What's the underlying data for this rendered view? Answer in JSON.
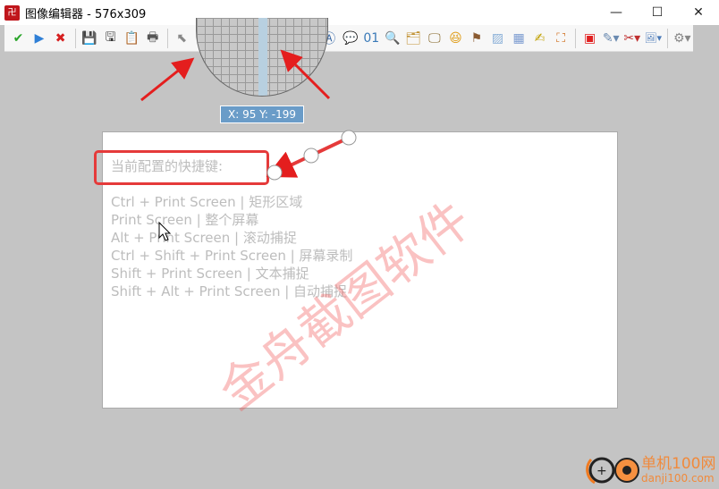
{
  "window": {
    "title": "图像编辑器 - 576x309",
    "minimize": "—",
    "maximize": "☐",
    "close": "✕"
  },
  "toolbar": [
    {
      "name": "apply",
      "glyph": "✔",
      "color": "#2aa52a"
    },
    {
      "name": "play",
      "glyph": "▶",
      "color": "#2f7fd6"
    },
    {
      "name": "cancel",
      "glyph": "✖",
      "color": "#d62020"
    },
    {
      "sep": true
    },
    {
      "name": "save",
      "glyph": "💾",
      "color": "#333"
    },
    {
      "name": "save-all",
      "glyph": "🖫",
      "color": "#333"
    },
    {
      "name": "clipboard",
      "glyph": "📋",
      "color": "#a07030"
    },
    {
      "name": "print",
      "glyph": "🖶",
      "color": "#555"
    },
    {
      "sep": true
    },
    {
      "name": "select",
      "glyph": "⬉",
      "color": "#888"
    },
    {
      "name": "rectangle",
      "glyph": "▭",
      "color": "#4a7ab8"
    },
    {
      "name": "ellipse",
      "glyph": "⬭",
      "color": "#4a7ab8"
    },
    {
      "name": "pencil",
      "glyph": "✎",
      "color": "#c08030"
    },
    {
      "name": "line",
      "glyph": "⟋",
      "color": "#4a7ab8"
    },
    {
      "name": "arrow",
      "glyph": "↘",
      "color": "#4a7ab8",
      "selected": true
    },
    {
      "name": "text",
      "glyph": "A",
      "color": "#3a6aa8"
    },
    {
      "name": "text-box",
      "glyph": "Ⓐ",
      "color": "#3a6aa8"
    },
    {
      "name": "speech-bubble",
      "glyph": "💬",
      "color": "#6a9ac8"
    },
    {
      "name": "counter",
      "glyph": "01",
      "color": "#3a7ab8"
    },
    {
      "name": "magnifier",
      "glyph": "🔍",
      "color": "#3a7ab8"
    },
    {
      "name": "image-insert",
      "glyph": "🗂",
      "color": "#c09030"
    },
    {
      "name": "screen",
      "glyph": "🖵",
      "color": "#806020"
    },
    {
      "name": "emoji",
      "glyph": "😆",
      "color": "#e0a020"
    },
    {
      "name": "stamp",
      "glyph": "⚑",
      "color": "#8a5a30"
    },
    {
      "name": "blur",
      "glyph": "▨",
      "color": "#8ab0d8"
    },
    {
      "name": "grid",
      "glyph": "▦",
      "color": "#7a9ad0"
    },
    {
      "name": "spell",
      "glyph": "✍",
      "color": "#c0a000"
    },
    {
      "name": "crop",
      "glyph": "⛶",
      "color": "#d07020"
    },
    {
      "sep": true
    },
    {
      "name": "border-color",
      "glyph": "▣",
      "color": "#e02020"
    },
    {
      "name": "fill-color",
      "glyph": "✎▾",
      "color": "#6a8ab0"
    },
    {
      "name": "tools",
      "glyph": "✂▾",
      "color": "#c03030"
    },
    {
      "name": "image-edit",
      "glyph": "🖼▾",
      "color": "#4a7ab8"
    },
    {
      "sep": true
    },
    {
      "name": "settings",
      "glyph": "⚙▾",
      "color": "#888"
    }
  ],
  "magnifier": {
    "coordinates": "X: 95 Y: -199"
  },
  "canvas": {
    "heading": "当前配置的快捷键:",
    "lines": [
      "Ctrl + Print Screen  |  矩形区域",
      "Print Screen  |  整个屏幕",
      "Alt + Print Screen  |  滚动捕捉",
      "Ctrl + Shift + Print Screen  |  屏幕录制",
      "Shift + Print Screen  |  文本捕捉",
      "Shift + Alt + Print Screen  |  自动捕捉"
    ],
    "watermark": "金舟截图软件"
  },
  "annotation_color": "#e53a3a",
  "logo": {
    "name": "单机100网",
    "url": "danji100.com"
  }
}
